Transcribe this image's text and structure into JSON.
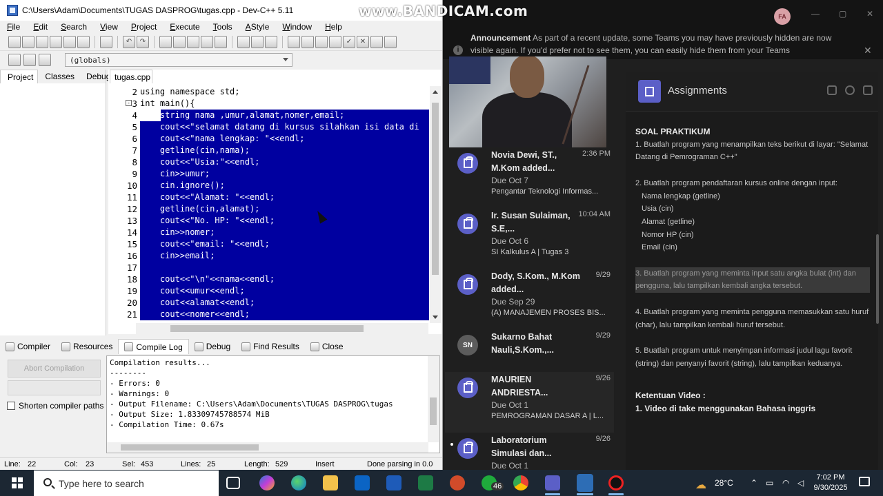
{
  "window": {
    "title": "C:\\Users\\Adam\\Documents\\TUGAS DASPROG\\tugas.cpp - Dev-C++ 5.11",
    "menu": [
      "File",
      "Edit",
      "Search",
      "View",
      "Project",
      "Execute",
      "Tools",
      "AStyle",
      "Window",
      "Help"
    ],
    "globals": "(globals)"
  },
  "left_tabs": [
    "Project",
    "Classes",
    "Debug"
  ],
  "editor_tab": "tugas.cpp",
  "code_lines": [
    {
      "n": "2",
      "t": "using namespace std;"
    },
    {
      "n": "3",
      "t": "int main(){"
    },
    {
      "n": "4",
      "t": "    string nama ,umur,alamat,nomer,email;"
    },
    {
      "n": "5",
      "t": "    cout<<\"selamat datang di kursus silahkan isi data di"
    },
    {
      "n": "6",
      "t": "    cout<<\"nama lengkap: \"<<endl;"
    },
    {
      "n": "7",
      "t": "    getline(cin,nama);"
    },
    {
      "n": "8",
      "t": "    cout<<\"Usia:\"<<endl;"
    },
    {
      "n": "9",
      "t": "    cin>>umur;"
    },
    {
      "n": "10",
      "t": "    cin.ignore();"
    },
    {
      "n": "11",
      "t": "    cout<<\"Alamat: \"<<endl;"
    },
    {
      "n": "12",
      "t": "    getline(cin,alamat);"
    },
    {
      "n": "13",
      "t": "    cout<<\"No. HP: \"<<endl;"
    },
    {
      "n": "14",
      "t": "    cin>>nomer;"
    },
    {
      "n": "15",
      "t": "    cout<<\"email: \"<<endl;"
    },
    {
      "n": "16",
      "t": "    cin>>email;"
    },
    {
      "n": "17",
      "t": ""
    },
    {
      "n": "18",
      "t": "    cout<<\"\\n\"<<nama<<endl;"
    },
    {
      "n": "19",
      "t": "    cout<<umur<<endl;"
    },
    {
      "n": "20",
      "t": "    cout<<alamat<<endl;"
    },
    {
      "n": "21",
      "t": "    cout<<nomer<<endl;"
    }
  ],
  "bottom_tabs": [
    "Compiler",
    "Resources",
    "Compile Log",
    "Debug",
    "Find Results",
    "Close"
  ],
  "abort_label": "Abort Compilation",
  "shorten_label": "Shorten compiler paths",
  "compile_log": "Compilation results...\n--------\n- Errors: 0\n- Warnings: 0\n- Output Filename: C:\\Users\\Adam\\Documents\\TUGAS DASPROG\\tugas\n- Output Size: 1.83309745788574 MiB\n- Compilation Time: 0.67s",
  "status": {
    "line": "Line:",
    "line_val": "22",
    "col": "Col:",
    "col_val": "23",
    "sel": "Sel:",
    "sel_val": "453",
    "lines": "Lines:",
    "lines_val": "25",
    "length": "Length:",
    "length_val": "529",
    "mode": "Insert",
    "parse": "Done parsing in 0.0"
  },
  "watermark": "www.BANDICAM.com",
  "avatar_initials": "FA",
  "announcement": {
    "bold": "Announcement",
    "text": " As part of a recent update, some Teams you may have previously hidden are now visible again. If you'd prefer not to see them, you can easily hide them from your Teams"
  },
  "assignments": [
    {
      "who": "Novia Dewi, ST., M.Kom added...",
      "when": "2:36 PM",
      "due": "Due Oct 7",
      "course": "Pengantar Teknologi Informas..."
    },
    {
      "who": "Ir. Susan Sulaiman, S.E,...",
      "when": "10:04 AM",
      "due": "Due Oct 6",
      "course": "SI Kalkulus A | Tugas 3"
    },
    {
      "who": "Dody, S.Kom., M.Kom added...",
      "when": "9/29",
      "due": "Due Sep 29",
      "course": "(A) MANAJEMEN PROSES BIS..."
    },
    {
      "who": "Sukarno Bahat Nauli,S.Kom.,...",
      "when": "9/29",
      "due": "",
      "course": "",
      "initials": "SN"
    },
    {
      "who": "MAURIEN ANDRIESTA...",
      "when": "9/26",
      "due": "Due Oct 1",
      "course": "PEMROGRAMAN DASAR A | L..."
    },
    {
      "who": "Laboratorium Simulasi dan...",
      "when": "9/26",
      "due": "Due Oct 1",
      "course": ""
    }
  ],
  "detail": {
    "title": "Assignments",
    "heading": "SOAL PRAKTIKUM",
    "p1": "1. Buatlah program yang menampilkan teks berikut di layar: \"Selamat Datang di Pemrograman C++\"",
    "p2": "2. Buatlah program pendaftaran kursus online dengan input:",
    "p2_items": [
      "Nama lengkap (getline)",
      "Usia (cin)",
      "Alamat (getline)",
      "Nomor HP (cin)",
      "Email (cin)"
    ],
    "p3_num": "3.",
    "p3": " Buatlah program yang meminta input satu angka bulat (int) dan pengguna, lalu tampilkan kembali angka tersebut.",
    "p4": "4. Buatlah program yang meminta pengguna memasukkan satu huruf (char), lalu tampilkan kembali huruf tersebut.",
    "p5": "5. Buatlah program untuk menyimpan informasi judul lagu favorit (string) dan penyanyi favorit (string), lalu tampilkan keduanya.",
    "ketentuan": "Ketentuan Video :",
    "k1": "1. Video di take menggunakan Bahasa inggris"
  },
  "taskbar": {
    "search_placeholder": "Type here to search",
    "badge": "46",
    "temp": "28°C",
    "time": "7:02 PM",
    "date": "9/30/2025"
  }
}
